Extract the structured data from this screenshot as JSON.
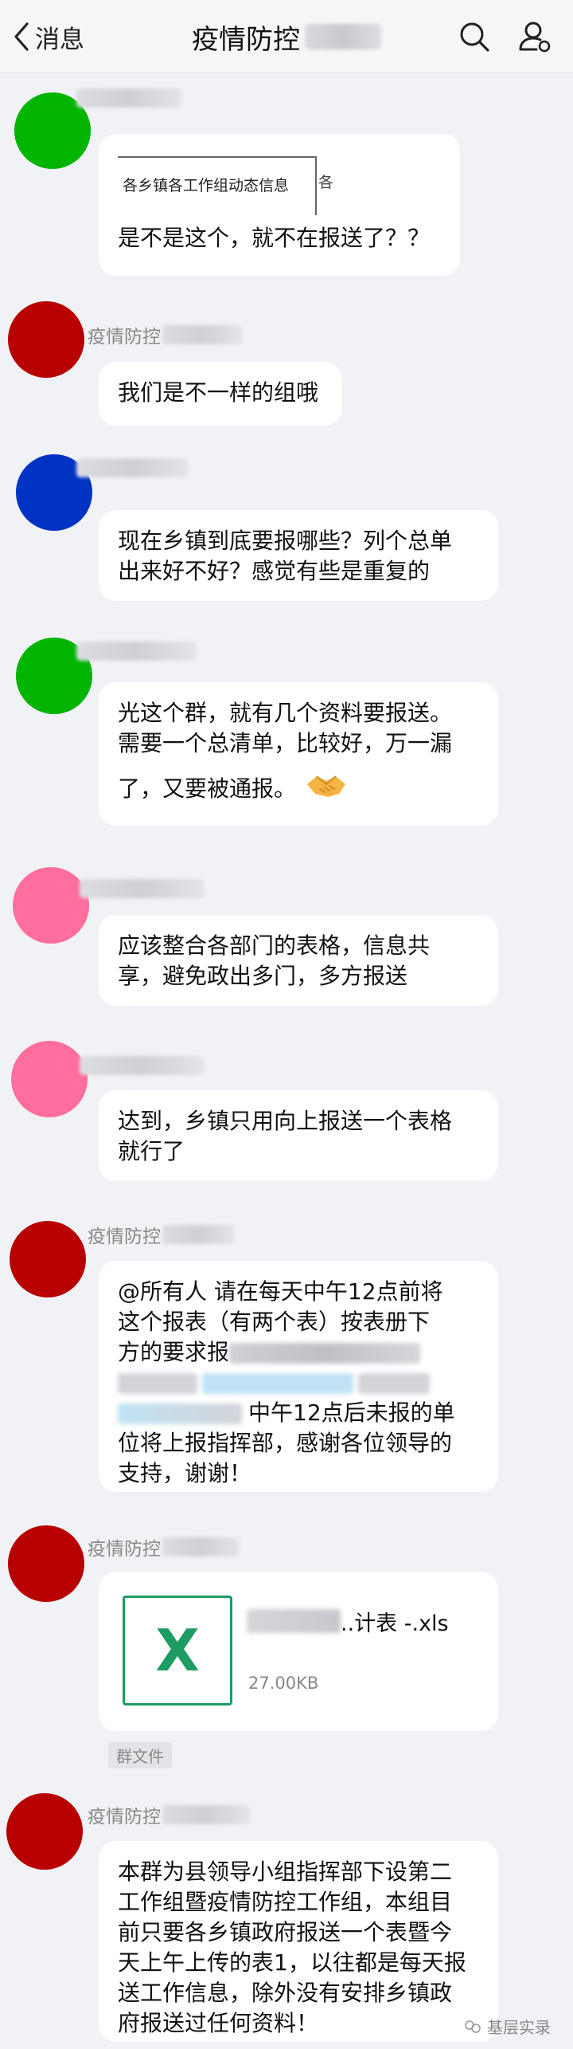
{
  "header": {
    "back_label": "消息",
    "title": "疫情防控"
  },
  "messages": [
    {
      "quote_text": "各乡镇各工作组动态信息",
      "quote_tail": "各",
      "lines": [
        "是不是这个，就不在报送了？？"
      ]
    },
    {
      "sender": "疫情防控",
      "lines": [
        "我们是不一样的组哦"
      ]
    },
    {
      "lines": [
        "现在乡镇到底要报哪些？列个总单",
        "出来好不好？感觉有些是重复的"
      ]
    },
    {
      "lines": [
        "光这个群，就有几个资料要报送。",
        "需要一个总清单，比较好，万一漏",
        "了，又要被通报。"
      ]
    },
    {
      "lines": [
        "应该整合各部门的表格，信息共",
        "享，避免政出多门，多方报送"
      ]
    },
    {
      "lines": [
        "达到，乡镇只用向上报送一个表格",
        "就行了"
      ]
    },
    {
      "sender": "疫情防控",
      "lines": [
        "@所有人  请在每天中午12点前将",
        "这个报表（有两个表）按表册下",
        "方的要求报",
        "中午12点后未报的单",
        "位将上报指挥部，感谢各位领导的",
        "支持，谢谢！"
      ]
    },
    {
      "sender": "疫情防控",
      "file_name": "..计表 -.xls",
      "file_size": "27.00KB",
      "file_icon_letter": "X",
      "group_file_label": "群文件"
    },
    {
      "sender": "疫情防控",
      "lines": [
        "本群为县领导小组指挥部下设第二",
        "工作组暨疫情防控工作组，本组目",
        "前只要各乡镇政府报送一个表暨今",
        "天上午上传的表1，以往都是每天报",
        "送工作信息，除外没有安排乡镇政",
        "府报送过任何资料！"
      ]
    }
  ],
  "watermark": {
    "text": "基层实录",
    "icon": "wechat-channel-icon"
  },
  "colors": {
    "avatar_green": "#00b400",
    "avatar_red": "#b80000",
    "avatar_blue": "#0033c4",
    "avatar_pink": "#ff6e9c",
    "excel_green": "#1c9c63",
    "background": "#f1f2f6"
  }
}
